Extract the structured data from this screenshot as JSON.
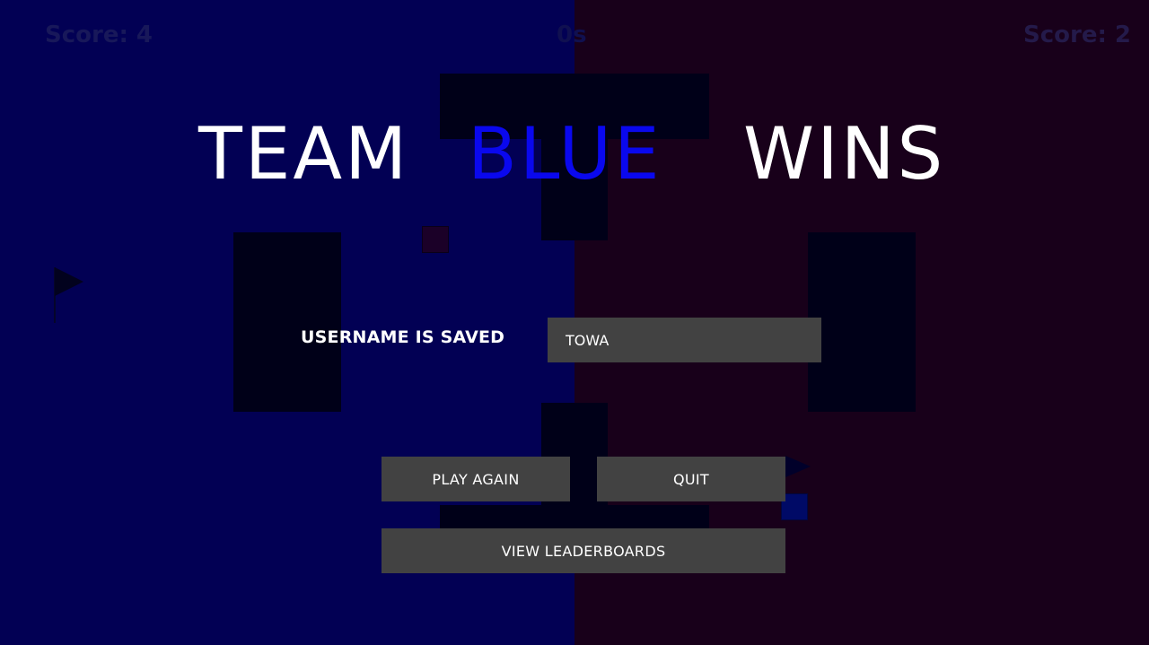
{
  "hud": {
    "score_left": "Score: 4",
    "timer": "0s",
    "score_right": "Score: 2"
  },
  "title": {
    "word1": "TEAM",
    "word2": "BLUE",
    "word3": "WINS",
    "winner_color": "#0a08ee"
  },
  "colors": {
    "blue_side": "#020054",
    "red_side": "#18001a",
    "button_bg": "#424242"
  },
  "username": {
    "label": "USERNAME IS SAVED",
    "value": "TOWA"
  },
  "buttons": {
    "play_again": "PLAY AGAIN",
    "quit": "QUIT",
    "leaderboards": "VIEW LEADERBOARDS"
  }
}
